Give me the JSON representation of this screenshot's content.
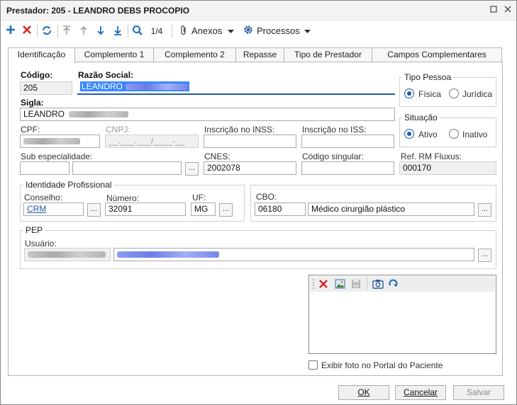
{
  "window": {
    "title": "Prestador: 205 - LEANDRO DEBS PROCOPIO"
  },
  "toolbar": {
    "record_counter": "1/4",
    "anexos_label": "Anexos",
    "processos_label": "Processos"
  },
  "tabs": [
    {
      "label": "Identificação"
    },
    {
      "label": "Complemento 1"
    },
    {
      "label": "Complemento 2"
    },
    {
      "label": "Repasse"
    },
    {
      "label": "Tipo de Prestador"
    },
    {
      "label": "Campos Complementares"
    }
  ],
  "form": {
    "codigo_label": "Código:",
    "codigo_value": "205",
    "razao_label": "Razão Social:",
    "razao_value": "LEANDRO",
    "sigla_label": "Sigla:",
    "sigla_value": "LEANDRO",
    "cpf_label": "CPF:",
    "cnpj_label": "CNPJ:",
    "cnpj_placeholder": "__.___.___/____-__",
    "inss_label": "Inscrição no INSS:",
    "iss_label": "Inscrição no ISS:",
    "subesp_label": "Sub especialidade:",
    "cnes_label": "CNES:",
    "cnes_value": "2002078",
    "codsing_label": "Código singular:",
    "refrm_label": "Ref. RM Fluxus:",
    "refrm_value": "000170",
    "ellipsis": "..."
  },
  "tipo_pessoa": {
    "title": "Tipo Pessoa",
    "opt1": "Física",
    "opt2": "Jurídica",
    "selected": "Física"
  },
  "situacao": {
    "title": "Situação",
    "opt1": "Ativo",
    "opt2": "Inativo",
    "selected": "Ativo"
  },
  "identidade": {
    "title": "Identidade Profissional",
    "conselho_label": "Conselho:",
    "conselho_value": "CRM",
    "numero_label": "Número:",
    "numero_value": "32091",
    "uf_label": "UF:",
    "uf_value": "MG"
  },
  "cbo": {
    "label": "CBO:",
    "code": "06180",
    "desc": "Médico cirurgião plástico"
  },
  "pep": {
    "title": "PEP",
    "usuario_label": "Usuário:"
  },
  "photo": {
    "checkbox_label": "Exibir foto no Portal do Paciente",
    "checked": false
  },
  "buttons": {
    "ok": "OK",
    "cancel": "Cancelar",
    "save": "Salvar"
  },
  "colors": {
    "accent": "#1f5aa8",
    "delete": "#d62828",
    "add": "#1f6fc0",
    "selection": "#3a86ff"
  }
}
